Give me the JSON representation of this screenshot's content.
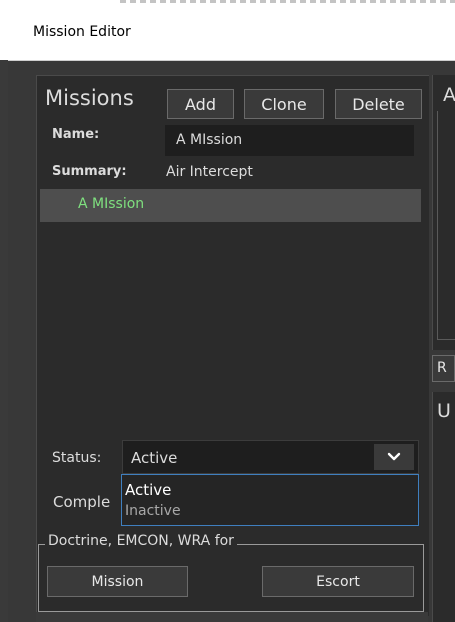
{
  "window": {
    "title": "Mission Editor"
  },
  "missions": {
    "heading": "Missions",
    "add_label": "Add",
    "clone_label": "Clone",
    "delete_label": "Delete",
    "name_label": "Name:",
    "name_value": "A MIssion",
    "summary_label": "Summary:",
    "summary_value": "Air Intercept",
    "list": [
      "A MIssion"
    ],
    "status_label": "Status:",
    "status_value": "Active",
    "status_options": [
      "Active",
      "Inactive"
    ],
    "comple_label": "Comple",
    "doctrine_legend": "Doctrine, EMCON, WRA for",
    "mission_button_label": "Mission",
    "escort_button_label": "Escort"
  },
  "right": {
    "panel_a_heading": "A",
    "r_button_label": "R",
    "panel_u_heading": "U"
  },
  "colors": {
    "background": "#383838",
    "panel": "#2b2b2b",
    "selected_mission_text": "#7fe07f",
    "dropdown_border": "#3f7fbf"
  },
  "icons": {
    "status_dropdown": "chevron-down-icon"
  }
}
